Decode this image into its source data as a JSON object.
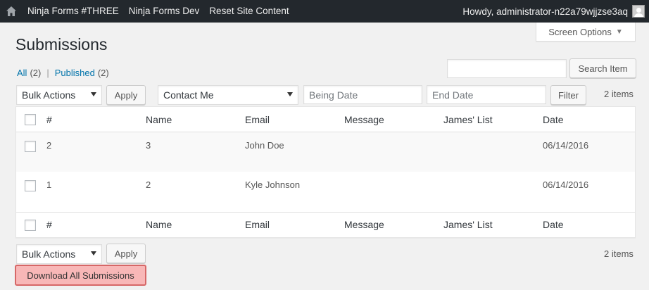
{
  "adminbar": {
    "home_icon": "home-icon",
    "items": [
      "Ninja Forms #THREE",
      "Ninja Forms Dev",
      "Reset Site Content"
    ],
    "howdy": "Howdy, administrator-n22a79wjjzse3aq"
  },
  "screen_options": {
    "label": "Screen Options",
    "icon": "caret-down-icon"
  },
  "page": {
    "title": "Submissions"
  },
  "views": {
    "all_label": "All",
    "all_count": "(2)",
    "separator": "|",
    "published_label": "Published",
    "published_count": "(2)"
  },
  "search": {
    "value": "",
    "button_label": "Search Item"
  },
  "top_nav": {
    "bulk_actions": "Bulk Actions",
    "apply_label": "Apply",
    "form_select": "Contact Me",
    "begin_date_placeholder": "Being Date",
    "end_date_placeholder": "End Date",
    "filter_label": "Filter",
    "items_count": "2 items"
  },
  "table": {
    "columns": [
      "#",
      "Name",
      "Email",
      "Message",
      "James' List",
      "Date"
    ],
    "rows": [
      {
        "num": "2",
        "name": "3",
        "email": "John Doe",
        "message": "",
        "james_list": "",
        "date": "06/14/2016"
      },
      {
        "num": "1",
        "name": "2",
        "email": "Kyle Johnson",
        "message": "",
        "james_list": "",
        "date": "06/14/2016"
      }
    ]
  },
  "bottom_nav": {
    "bulk_actions": "Bulk Actions",
    "apply_label": "Apply",
    "items_count": "2 items"
  },
  "download": {
    "label": "Download All Submissions"
  },
  "colors": {
    "adminbar_bg": "#23282d",
    "link": "#0073aa",
    "highlight_bg": "#f8b7b7",
    "highlight_border": "#d66767"
  }
}
